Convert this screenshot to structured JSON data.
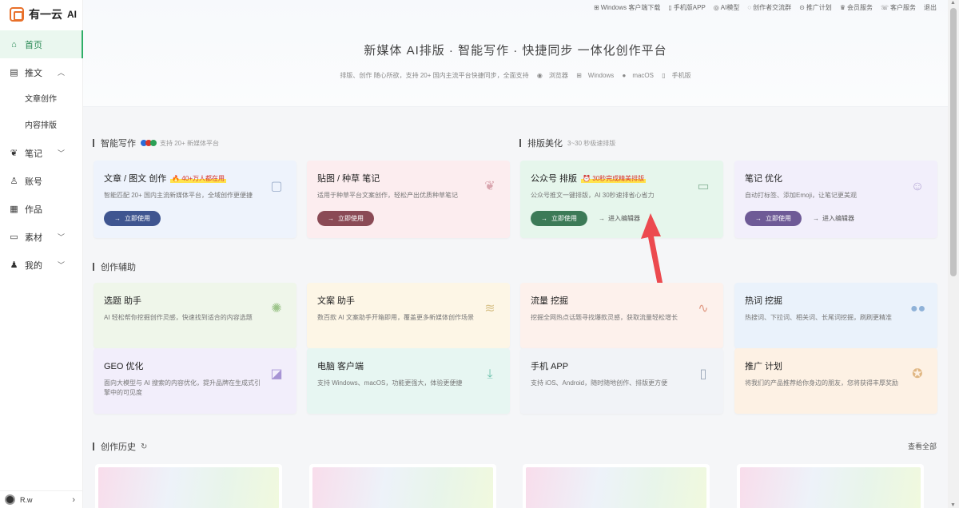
{
  "brand": {
    "logo_text": "有一云",
    "logo_suffix": "AI"
  },
  "sidebar": {
    "items": [
      {
        "label": "首页",
        "icon": "home-icon"
      },
      {
        "label": "推文",
        "icon": "doc-icon"
      },
      {
        "label": "文章创作"
      },
      {
        "label": "内容排版"
      },
      {
        "label": "笔记",
        "icon": "leaf-icon"
      },
      {
        "label": "账号",
        "icon": "account-icon"
      },
      {
        "label": "作品",
        "icon": "works-icon"
      },
      {
        "label": "素材",
        "icon": "folder-icon"
      },
      {
        "label": "我的",
        "icon": "user-icon"
      }
    ],
    "user_name": "R.w"
  },
  "topbar": [
    "Windows 客户端下载",
    "手机版APP",
    "AI模型",
    "创作者交流群",
    "推广计划",
    "会员服务",
    "客户服务",
    "退出"
  ],
  "hero": {
    "title": "新媒体 AI排版 · 智能写作 · 快捷同步 一体化创作平台",
    "subtitle": "排版、创作 随心所欲，支持 20+ 国内主流平台快捷同步，全面支持",
    "platforms": [
      "浏览器",
      "Windows",
      "macOS",
      "手机版"
    ]
  },
  "sections": {
    "writing": {
      "title": "智能写作",
      "note": "支持 20+ 新媒体平台"
    },
    "layout": {
      "title": "排版美化",
      "note": "3~30 秒极速排版"
    },
    "assist": {
      "title": "创作辅助"
    },
    "history": {
      "title": "创作历史",
      "view_all": "查看全部"
    }
  },
  "main_cards": [
    {
      "title": "文章 / 图文 创作",
      "badge": "🔥 40+万人都在用",
      "desc": "智能匹配 20+ 国内主流新媒体平台，全域创作更便捷",
      "btn": "立即使用",
      "color": "#eef3fc",
      "btn_color": "#3f5590"
    },
    {
      "title": "贴图 / 种草 笔记",
      "desc": "适用于种草平台文案创作，轻松产出优质种草笔记",
      "btn": "立即使用",
      "color": "#fcedef",
      "btn_color": "#8a4a55"
    },
    {
      "title": "公众号 排版",
      "badge": "⏰ 30秒完成精美排版",
      "desc": "公众号推文一键排版，AI 30秒速排省心省力",
      "btn": "立即使用",
      "link": "进入编辑器",
      "color": "#e6f6ec",
      "btn_color": "#3c7a57"
    },
    {
      "title": "笔记 优化",
      "desc": "自动打标签、添加Emoji，让笔记更美观",
      "btn": "立即使用",
      "link": "进入编辑器",
      "color": "#f2effb",
      "btn_color": "#6e5a96"
    }
  ],
  "assist_cards": [
    {
      "title": "选题 助手",
      "desc": "AI 轻松帮你挖掘创作灵感，快速找到适合的内容选题",
      "color": "#eff6ea",
      "icon_color": "#9cc48a"
    },
    {
      "title": "文案 助手",
      "desc": "数百款 AI 文案助手开箱即用，覆盖更多新媒体创作场景",
      "color": "#fdf6e6",
      "icon_color": "#d8c28a"
    },
    {
      "title": "流量 挖掘",
      "desc": "挖掘全网热点话题寻找爆款灵感，获取流量轻松增长",
      "color": "#fdf1ec",
      "icon_color": "#e09a84"
    },
    {
      "title": "热词 挖掘",
      "desc": "热搜词、下拉词、相关词、长尾词挖掘，刷刷更精准",
      "color": "#eaf2fb",
      "icon_color": "#8fb2d8"
    },
    {
      "title": "GEO 优化",
      "desc": "面向大模型与 AI 搜索的内容优化，提升品牌在生成式引擎中的可见度",
      "color": "#f2eefb",
      "icon_color": "#a794d4"
    },
    {
      "title": "电脑 客户端",
      "desc": "支持 Windows、macOS，功能更强大，体验更便捷",
      "color": "#e7f6f2",
      "icon_color": "#6fc1ad"
    },
    {
      "title": "手机 APP",
      "desc": "支持 iOS、Android，随时随地创作、排版更方便",
      "color": "#f1f3f7",
      "icon_color": "#9aa6b8"
    },
    {
      "title": "推广 计划",
      "desc": "将我们的产品推荐给你身边的朋友，您将获得丰厚奖励",
      "color": "#fdf1e4",
      "icon_color": "#e0b784"
    }
  ]
}
